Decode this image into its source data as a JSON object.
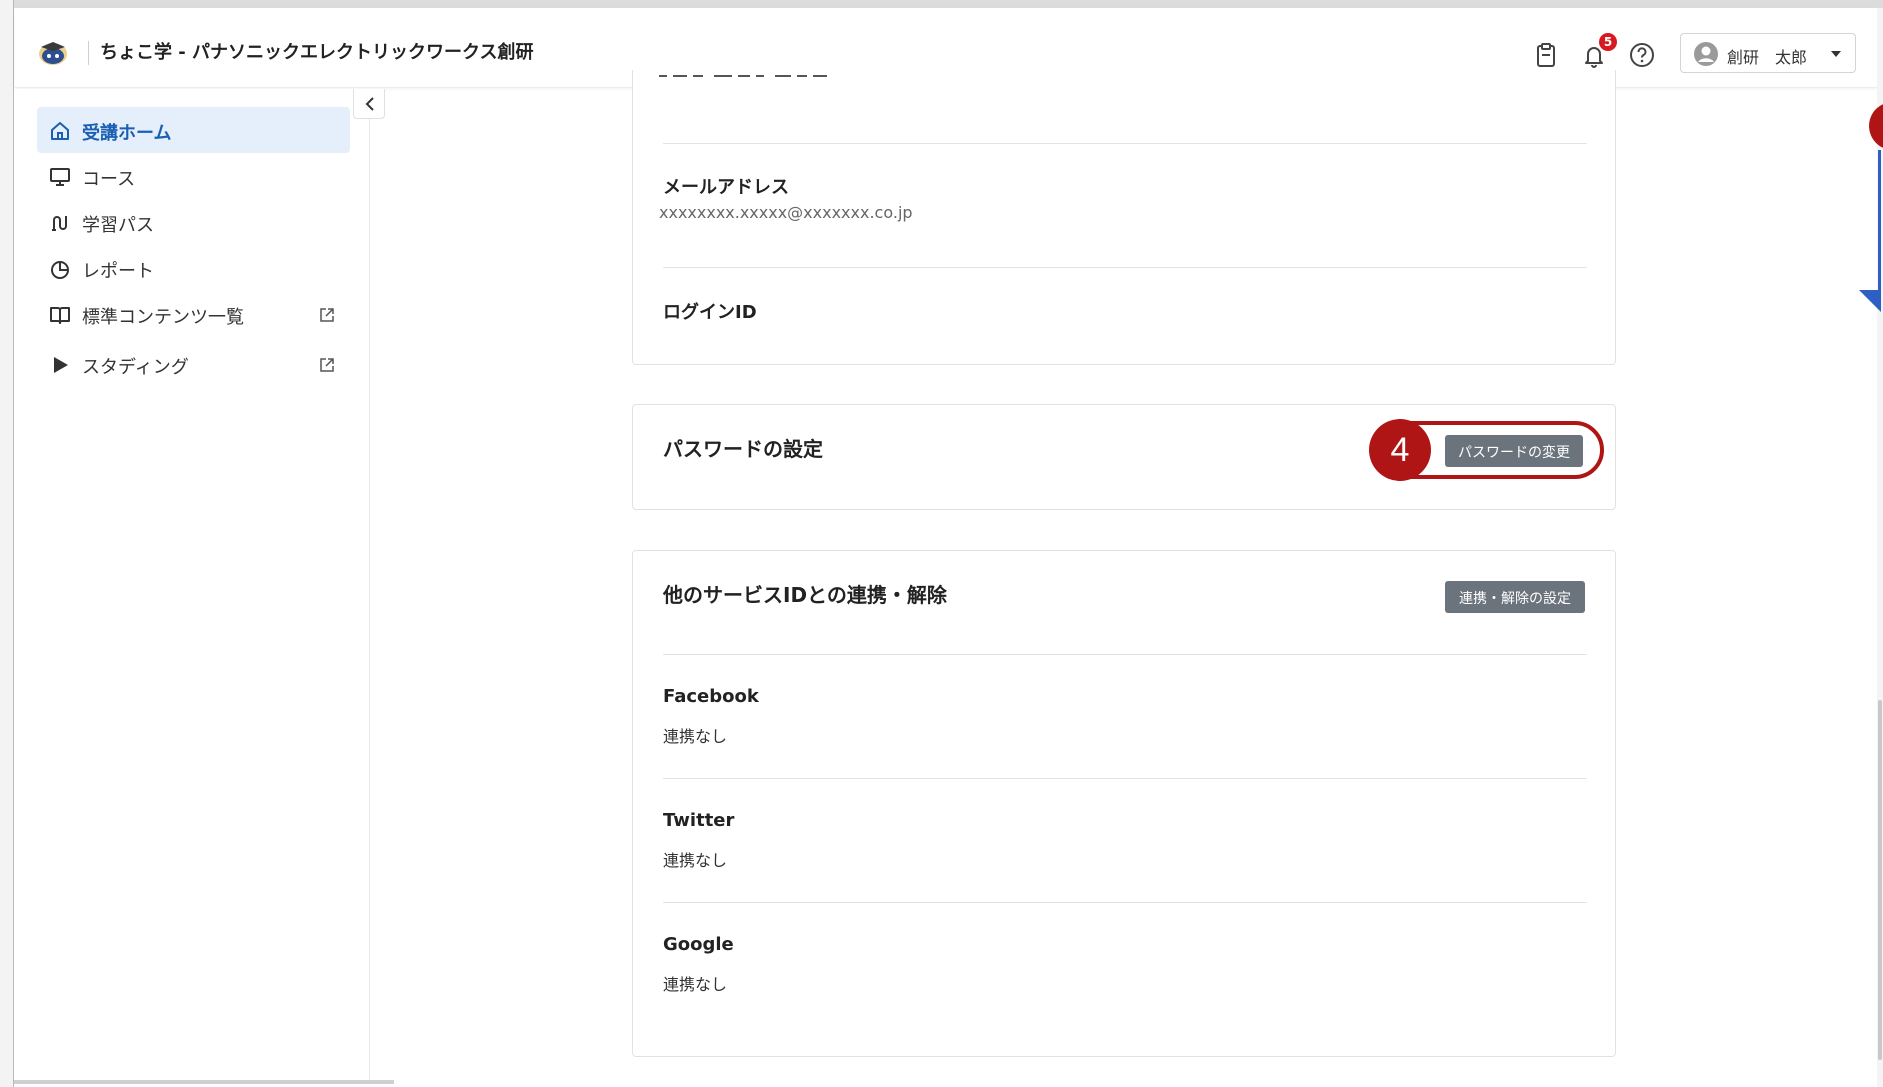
{
  "header": {
    "app_title": "ちょこ学 - パナソニックエレクトリックワークス創研",
    "notification_count": "5",
    "user_name": "創研　太郎"
  },
  "sidebar": {
    "items": [
      {
        "label": "受講ホーム",
        "icon": "home-icon",
        "active": true,
        "external": false
      },
      {
        "label": "コース",
        "icon": "monitor-icon",
        "active": false,
        "external": false
      },
      {
        "label": "学習パス",
        "icon": "path-icon",
        "active": false,
        "external": false
      },
      {
        "label": "レポート",
        "icon": "pie-chart-icon",
        "active": false,
        "external": false
      },
      {
        "label": "標準コンテンツ一覧",
        "icon": "book-icon",
        "active": false,
        "external": true
      },
      {
        "label": "スタディング",
        "icon": "play-icon",
        "active": false,
        "external": true
      }
    ]
  },
  "account": {
    "email_label": "メールアドレス",
    "email_value": "xxxxxxxx.xxxxx@xxxxxxx.co.jp",
    "login_id_label": "ログインID"
  },
  "password": {
    "title": "パスワードの設定",
    "change_button": "パスワードの変更",
    "callout_number": "4"
  },
  "linking": {
    "title": "他のサービスIDとの連携・解除",
    "settings_button": "連携・解除の設定",
    "services": [
      {
        "name": "Facebook",
        "status": "連携なし"
      },
      {
        "name": "Twitter",
        "status": "連携なし"
      },
      {
        "name": "Google",
        "status": "連携なし"
      }
    ]
  },
  "colors": {
    "accent_active": "#1a5fb4",
    "active_bg": "#e4effb",
    "callout_red": "#b01515",
    "button_gray": "#6b747d",
    "badge_red": "#d71920"
  }
}
